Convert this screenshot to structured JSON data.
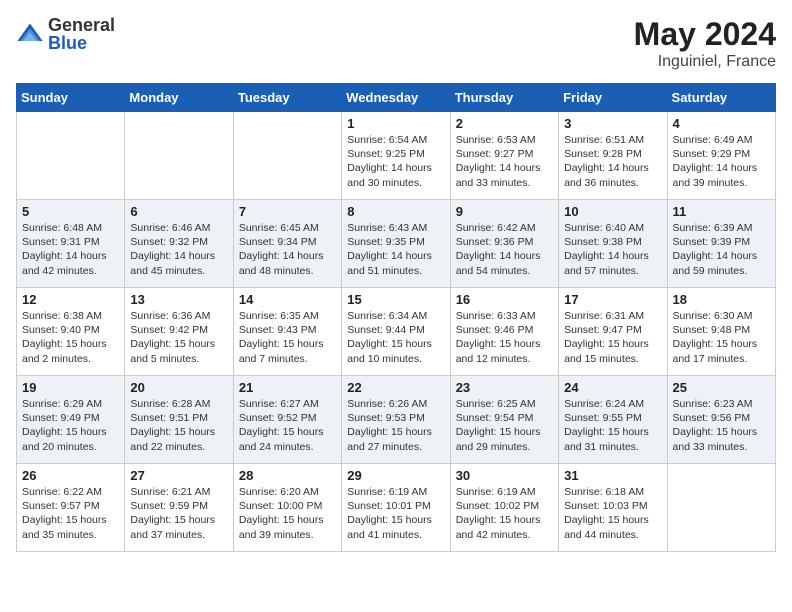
{
  "header": {
    "logo_general": "General",
    "logo_blue": "Blue",
    "title": "May 2024",
    "subtitle": "Inguiniel, France"
  },
  "days_of_week": [
    "Sunday",
    "Monday",
    "Tuesday",
    "Wednesday",
    "Thursday",
    "Friday",
    "Saturday"
  ],
  "weeks": [
    [
      {
        "day": "",
        "sunrise": "",
        "sunset": "",
        "daylight": ""
      },
      {
        "day": "",
        "sunrise": "",
        "sunset": "",
        "daylight": ""
      },
      {
        "day": "",
        "sunrise": "",
        "sunset": "",
        "daylight": ""
      },
      {
        "day": "1",
        "sunrise": "Sunrise: 6:54 AM",
        "sunset": "Sunset: 9:25 PM",
        "daylight": "Daylight: 14 hours and 30 minutes."
      },
      {
        "day": "2",
        "sunrise": "Sunrise: 6:53 AM",
        "sunset": "Sunset: 9:27 PM",
        "daylight": "Daylight: 14 hours and 33 minutes."
      },
      {
        "day": "3",
        "sunrise": "Sunrise: 6:51 AM",
        "sunset": "Sunset: 9:28 PM",
        "daylight": "Daylight: 14 hours and 36 minutes."
      },
      {
        "day": "4",
        "sunrise": "Sunrise: 6:49 AM",
        "sunset": "Sunset: 9:29 PM",
        "daylight": "Daylight: 14 hours and 39 minutes."
      }
    ],
    [
      {
        "day": "5",
        "sunrise": "Sunrise: 6:48 AM",
        "sunset": "Sunset: 9:31 PM",
        "daylight": "Daylight: 14 hours and 42 minutes."
      },
      {
        "day": "6",
        "sunrise": "Sunrise: 6:46 AM",
        "sunset": "Sunset: 9:32 PM",
        "daylight": "Daylight: 14 hours and 45 minutes."
      },
      {
        "day": "7",
        "sunrise": "Sunrise: 6:45 AM",
        "sunset": "Sunset: 9:34 PM",
        "daylight": "Daylight: 14 hours and 48 minutes."
      },
      {
        "day": "8",
        "sunrise": "Sunrise: 6:43 AM",
        "sunset": "Sunset: 9:35 PM",
        "daylight": "Daylight: 14 hours and 51 minutes."
      },
      {
        "day": "9",
        "sunrise": "Sunrise: 6:42 AM",
        "sunset": "Sunset: 9:36 PM",
        "daylight": "Daylight: 14 hours and 54 minutes."
      },
      {
        "day": "10",
        "sunrise": "Sunrise: 6:40 AM",
        "sunset": "Sunset: 9:38 PM",
        "daylight": "Daylight: 14 hours and 57 minutes."
      },
      {
        "day": "11",
        "sunrise": "Sunrise: 6:39 AM",
        "sunset": "Sunset: 9:39 PM",
        "daylight": "Daylight: 14 hours and 59 minutes."
      }
    ],
    [
      {
        "day": "12",
        "sunrise": "Sunrise: 6:38 AM",
        "sunset": "Sunset: 9:40 PM",
        "daylight": "Daylight: 15 hours and 2 minutes."
      },
      {
        "day": "13",
        "sunrise": "Sunrise: 6:36 AM",
        "sunset": "Sunset: 9:42 PM",
        "daylight": "Daylight: 15 hours and 5 minutes."
      },
      {
        "day": "14",
        "sunrise": "Sunrise: 6:35 AM",
        "sunset": "Sunset: 9:43 PM",
        "daylight": "Daylight: 15 hours and 7 minutes."
      },
      {
        "day": "15",
        "sunrise": "Sunrise: 6:34 AM",
        "sunset": "Sunset: 9:44 PM",
        "daylight": "Daylight: 15 hours and 10 minutes."
      },
      {
        "day": "16",
        "sunrise": "Sunrise: 6:33 AM",
        "sunset": "Sunset: 9:46 PM",
        "daylight": "Daylight: 15 hours and 12 minutes."
      },
      {
        "day": "17",
        "sunrise": "Sunrise: 6:31 AM",
        "sunset": "Sunset: 9:47 PM",
        "daylight": "Daylight: 15 hours and 15 minutes."
      },
      {
        "day": "18",
        "sunrise": "Sunrise: 6:30 AM",
        "sunset": "Sunset: 9:48 PM",
        "daylight": "Daylight: 15 hours and 17 minutes."
      }
    ],
    [
      {
        "day": "19",
        "sunrise": "Sunrise: 6:29 AM",
        "sunset": "Sunset: 9:49 PM",
        "daylight": "Daylight: 15 hours and 20 minutes."
      },
      {
        "day": "20",
        "sunrise": "Sunrise: 6:28 AM",
        "sunset": "Sunset: 9:51 PM",
        "daylight": "Daylight: 15 hours and 22 minutes."
      },
      {
        "day": "21",
        "sunrise": "Sunrise: 6:27 AM",
        "sunset": "Sunset: 9:52 PM",
        "daylight": "Daylight: 15 hours and 24 minutes."
      },
      {
        "day": "22",
        "sunrise": "Sunrise: 6:26 AM",
        "sunset": "Sunset: 9:53 PM",
        "daylight": "Daylight: 15 hours and 27 minutes."
      },
      {
        "day": "23",
        "sunrise": "Sunrise: 6:25 AM",
        "sunset": "Sunset: 9:54 PM",
        "daylight": "Daylight: 15 hours and 29 minutes."
      },
      {
        "day": "24",
        "sunrise": "Sunrise: 6:24 AM",
        "sunset": "Sunset: 9:55 PM",
        "daylight": "Daylight: 15 hours and 31 minutes."
      },
      {
        "day": "25",
        "sunrise": "Sunrise: 6:23 AM",
        "sunset": "Sunset: 9:56 PM",
        "daylight": "Daylight: 15 hours and 33 minutes."
      }
    ],
    [
      {
        "day": "26",
        "sunrise": "Sunrise: 6:22 AM",
        "sunset": "Sunset: 9:57 PM",
        "daylight": "Daylight: 15 hours and 35 minutes."
      },
      {
        "day": "27",
        "sunrise": "Sunrise: 6:21 AM",
        "sunset": "Sunset: 9:59 PM",
        "daylight": "Daylight: 15 hours and 37 minutes."
      },
      {
        "day": "28",
        "sunrise": "Sunrise: 6:20 AM",
        "sunset": "Sunset: 10:00 PM",
        "daylight": "Daylight: 15 hours and 39 minutes."
      },
      {
        "day": "29",
        "sunrise": "Sunrise: 6:19 AM",
        "sunset": "Sunset: 10:01 PM",
        "daylight": "Daylight: 15 hours and 41 minutes."
      },
      {
        "day": "30",
        "sunrise": "Sunrise: 6:19 AM",
        "sunset": "Sunset: 10:02 PM",
        "daylight": "Daylight: 15 hours and 42 minutes."
      },
      {
        "day": "31",
        "sunrise": "Sunrise: 6:18 AM",
        "sunset": "Sunset: 10:03 PM",
        "daylight": "Daylight: 15 hours and 44 minutes."
      },
      {
        "day": "",
        "sunrise": "",
        "sunset": "",
        "daylight": ""
      }
    ]
  ]
}
